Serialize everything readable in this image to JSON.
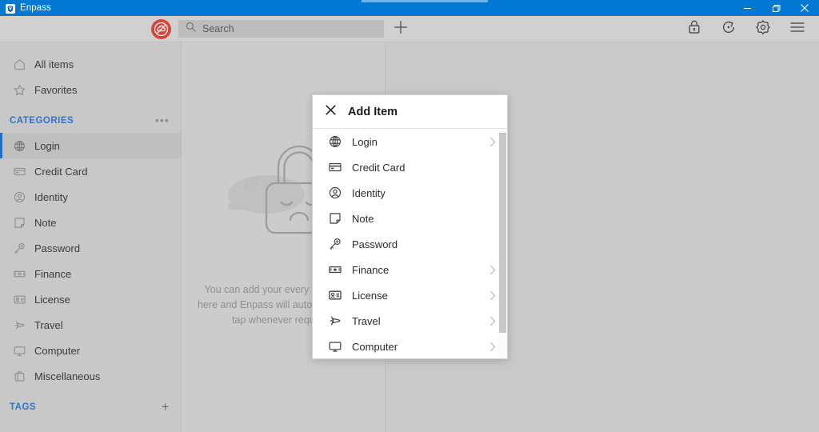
{
  "window": {
    "title": "Enpass",
    "app_icon": "shield-icon",
    "controls": {
      "minimize": "minimize-icon",
      "maximize": "restore-icon",
      "close": "close-icon"
    },
    "accent_color": "#0078d4"
  },
  "toolbar": {
    "sync_status_icon": "cloud-off-icon",
    "sync_status_color": "#d8453c",
    "search": {
      "icon": "search-icon",
      "placeholder": "Search",
      "value": ""
    },
    "add_label": "+",
    "add_icon": "plus-icon",
    "right_buttons": [
      {
        "name": "lock-button",
        "icon": "lock-icon"
      },
      {
        "name": "sync-button",
        "icon": "refresh-icon"
      },
      {
        "name": "settings-button",
        "icon": "gear-icon"
      },
      {
        "name": "menu-button",
        "icon": "hamburger-icon"
      }
    ]
  },
  "sidebar": {
    "top_items": [
      {
        "label": "All items",
        "icon": "home-icon"
      },
      {
        "label": "Favorites",
        "icon": "star-icon"
      }
    ],
    "categories_header": {
      "label": "CATEGORIES",
      "color": "#2e74c8",
      "overflow_icon": "ellipsis-icon"
    },
    "categories": [
      {
        "label": "Login",
        "icon": "globe-icon",
        "selected": true
      },
      {
        "label": "Credit Card",
        "icon": "credit-card-icon",
        "selected": false
      },
      {
        "label": "Identity",
        "icon": "identity-icon",
        "selected": false
      },
      {
        "label": "Note",
        "icon": "note-icon",
        "selected": false
      },
      {
        "label": "Password",
        "icon": "key-icon",
        "selected": false
      },
      {
        "label": "Finance",
        "icon": "banknote-icon",
        "selected": false
      },
      {
        "label": "License",
        "icon": "license-icon",
        "selected": false
      },
      {
        "label": "Travel",
        "icon": "airplane-icon",
        "selected": false
      },
      {
        "label": "Computer",
        "icon": "monitor-icon",
        "selected": false
      },
      {
        "label": "Miscellaneous",
        "icon": "briefcase-icon",
        "selected": false
      }
    ],
    "tags_header": {
      "label": "TAGS",
      "color": "#2e74c8",
      "add_icon": "plus-icon"
    }
  },
  "list_pane": {
    "empty_state": {
      "illustration": "sleeping-sad-lock-icon",
      "message": "You can add your every single login here and Enpass will auto-fill them in a tap whenever required."
    }
  },
  "dialog": {
    "title": "Add Item",
    "close_icon": "close-icon",
    "items": [
      {
        "label": "Login",
        "icon": "globe-icon",
        "has_submenu": true
      },
      {
        "label": "Credit Card",
        "icon": "credit-card-icon",
        "has_submenu": false
      },
      {
        "label": "Identity",
        "icon": "identity-icon",
        "has_submenu": false
      },
      {
        "label": "Note",
        "icon": "note-icon",
        "has_submenu": false
      },
      {
        "label": "Password",
        "icon": "key-icon",
        "has_submenu": false
      },
      {
        "label": "Finance",
        "icon": "banknote-icon",
        "has_submenu": true
      },
      {
        "label": "License",
        "icon": "license-icon",
        "has_submenu": true
      },
      {
        "label": "Travel",
        "icon": "airplane-icon",
        "has_submenu": true
      },
      {
        "label": "Computer",
        "icon": "monitor-icon",
        "has_submenu": true
      }
    ],
    "scrollbar": {
      "name": "dialog-scrollbar"
    }
  }
}
